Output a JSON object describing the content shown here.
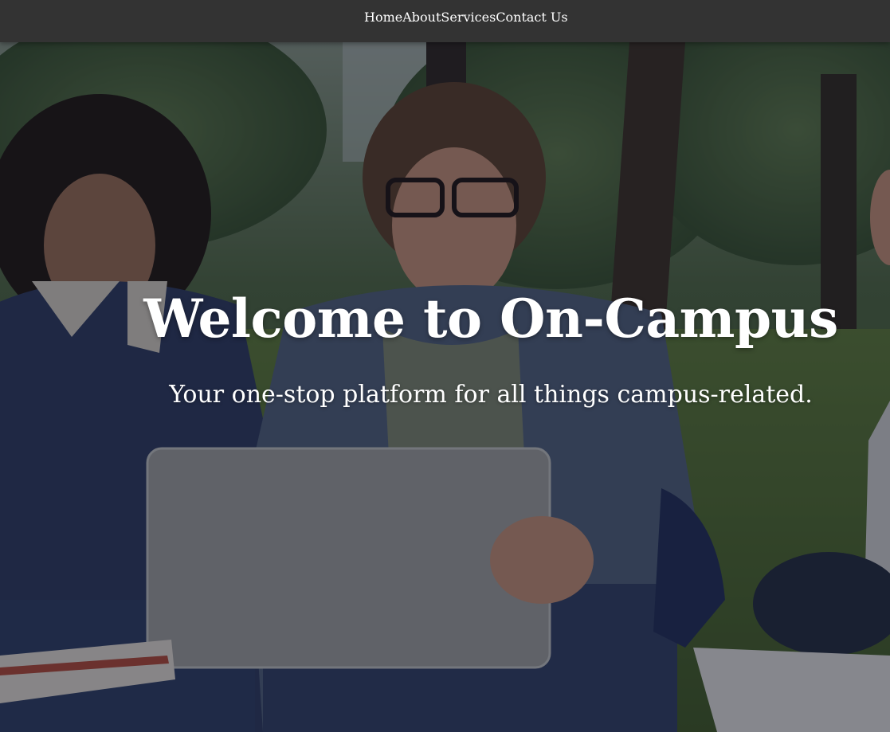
{
  "nav": {
    "items": [
      {
        "label": "Home"
      },
      {
        "label": "About"
      },
      {
        "label": "Services"
      },
      {
        "label": "Contact Us"
      }
    ]
  },
  "hero": {
    "title": "Welcome to On-Campus",
    "subtitle": "Your one-stop platform for all things campus-related.",
    "background": "photo of students sitting on campus lawn with a laptop"
  },
  "colors": {
    "navbar_bg": "#333333",
    "text": "#ffffff",
    "overlay": "#121422"
  }
}
